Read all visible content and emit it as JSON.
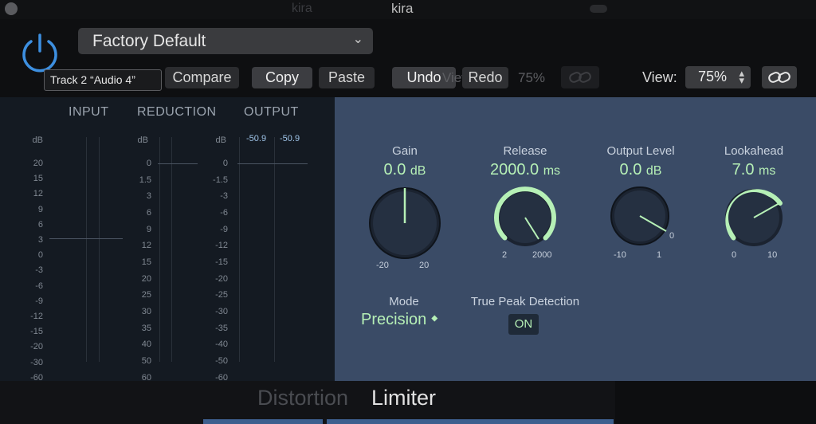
{
  "window": {
    "title": "kira",
    "background_title": "kira"
  },
  "header": {
    "preset": "Factory Default",
    "tooltip": "Track 2 “Audio 4”",
    "buttons": {
      "compare": "Compare",
      "copy": "Copy",
      "paste": "Paste",
      "undo": "Undo",
      "redo": "Redo"
    },
    "view_label": "View:",
    "view_value": "75%",
    "ghost_view": "View",
    "ghost_pct": "75%"
  },
  "meters": {
    "heads": {
      "input": "INPUT",
      "reduction": "REDUCTION",
      "output": "OUTPUT"
    },
    "db": "dB",
    "input_scale": [
      "20",
      "15",
      "12",
      "9",
      "6",
      "3",
      "0",
      "-3",
      "-6",
      "-9",
      "-12",
      "-15",
      "-20",
      "-30",
      "-60"
    ],
    "reduction_scale": [
      "0",
      "1.5",
      "3",
      "6",
      "9",
      "12",
      "15",
      "20",
      "25",
      "30",
      "35",
      "40",
      "50",
      "60"
    ],
    "output_scale": [
      "0",
      "-1.5",
      "-3",
      "-6",
      "-9",
      "-12",
      "-15",
      "-20",
      "-25",
      "-30",
      "-35",
      "-40",
      "-50",
      "-60"
    ],
    "output_values": [
      "-50.9",
      "-50.9"
    ]
  },
  "controls": {
    "gain": {
      "label": "Gain",
      "value": "0.0",
      "unit": "dB",
      "min": "-20",
      "max": "20"
    },
    "release": {
      "label": "Release",
      "value": "2000.0",
      "unit": "ms",
      "min": "2",
      "max": "2000"
    },
    "output_level": {
      "label": "Output Level",
      "value": "0.0",
      "unit": "dB",
      "min": "-10",
      "max": "1",
      "mark": "0"
    },
    "lookahead": {
      "label": "Lookahead",
      "value": "7.0",
      "unit": "ms",
      "min": "0",
      "max": "10"
    },
    "mode": {
      "label": "Mode",
      "value": "Precision",
      "arrow": "⯁"
    },
    "true_peak": {
      "label": "True Peak Detection",
      "value": "ON"
    }
  },
  "tabs": {
    "distortion": "Distortion",
    "limiter": "Limiter"
  },
  "colors": {
    "accent_green": "#b6f0b6",
    "panel_blue": "#3a4b66",
    "power_blue": "#3d8fe0"
  }
}
